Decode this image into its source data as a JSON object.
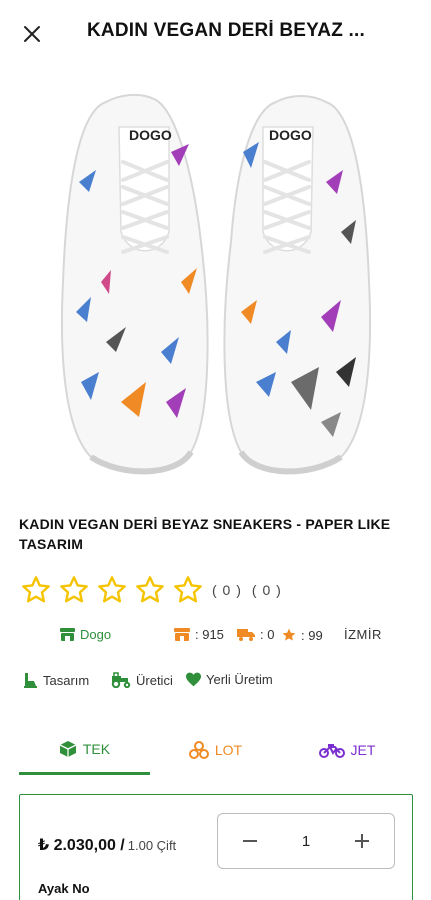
{
  "header": {
    "title": "KADIN VEGAN DERİ BEYAZ ...",
    "close_icon": "close-icon"
  },
  "product": {
    "image_brand_text": "DOGO",
    "name": "KADIN VEGAN DERİ BEYAZ SNEAKERS - PAPER LIKE TASARIM",
    "rating": 0,
    "rating_count": "( 0 )",
    "review_count": "( 0 )"
  },
  "meta": {
    "brand": "Dogo",
    "shop_count": ": 915",
    "shipping_count": ": 0",
    "star_count": ": 99",
    "city": "İZMİR"
  },
  "badges": [
    {
      "label": "Tasarım",
      "icon": "design-icon"
    },
    {
      "label": "Üretici",
      "icon": "tractor-icon"
    },
    {
      "label": "Yerli Üretim",
      "icon": "heart-icon"
    }
  ],
  "tabs": [
    {
      "label": "TEK",
      "icon": "box-icon",
      "active": true
    },
    {
      "label": "LOT",
      "icon": "boxes-icon",
      "active": false
    },
    {
      "label": "JET",
      "icon": "motorcycle-icon",
      "active": false
    }
  ],
  "order": {
    "price": "₺ 2.030,00 /",
    "unit": "1.00 Çift",
    "quantity": "1",
    "size_label": "Ayak No"
  },
  "colors": {
    "green": "#2f8f3a",
    "orange": "#f08a24",
    "purple": "#7b2fd1",
    "star_yellow": "#f5c400"
  }
}
